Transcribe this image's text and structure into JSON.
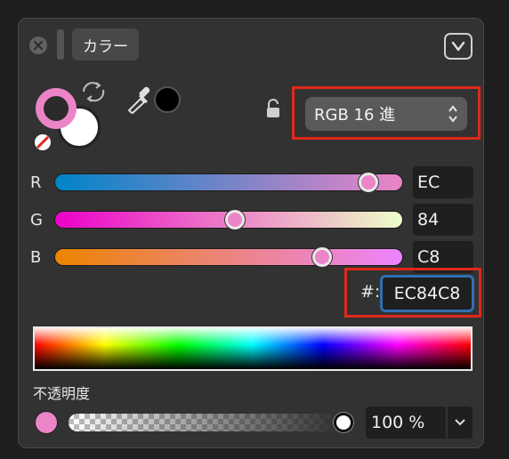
{
  "window": {
    "title": "カラー"
  },
  "colors": {
    "current": "#ec84c8",
    "accent": "#2f6fb2",
    "highlight": "#e0281a"
  },
  "mode_select": {
    "value": "RGB 16 進"
  },
  "channels": [
    {
      "label": "R",
      "value": "EC",
      "fraction": 0.925
    },
    {
      "label": "G",
      "value": "84",
      "fraction": 0.518
    },
    {
      "label": "B",
      "value": "C8",
      "fraction": 0.784
    }
  ],
  "hex": {
    "label": "#:",
    "value": "EC84C8"
  },
  "opacity": {
    "label": "不透明度",
    "value": "100 %",
    "fraction": 1.0
  },
  "icons": {
    "close": "close-icon",
    "collapse": "chevron-down-icon",
    "swap": "swap-arrows-icon",
    "none": "no-color-icon",
    "eyedropper": "eyedropper-icon",
    "lock": "lock-icon",
    "stepper": "up-down-chevron-icon"
  }
}
